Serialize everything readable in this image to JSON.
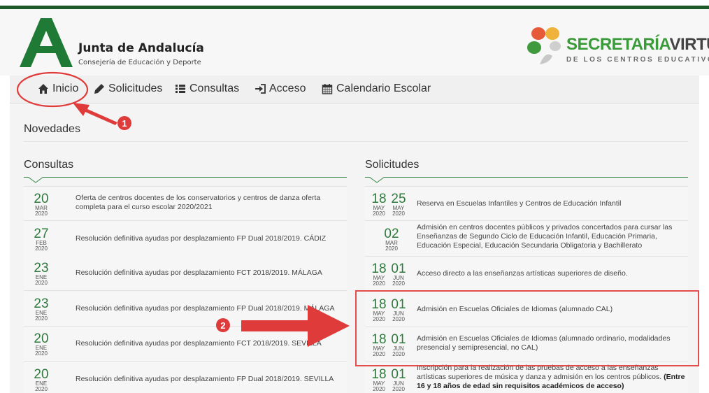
{
  "header": {
    "org_name": "Junta de Andalucía",
    "org_sub": "Consejería de Educación y Deporte",
    "sv_title_a": "SECRETARÍA",
    "sv_title_b": "VIRTUAL",
    "sv_sub": "DE LOS CENTROS EDUCATIVOS"
  },
  "nav": {
    "items": [
      {
        "label": "Inicio",
        "icon": "home-icon"
      },
      {
        "label": "Solicitudes",
        "icon": "pencil-icon"
      },
      {
        "label": "Consultas",
        "icon": "list-icon"
      },
      {
        "label": "Acceso",
        "icon": "sign-in-icon"
      },
      {
        "label": "Calendario Escolar",
        "icon": "calendar-icon"
      }
    ]
  },
  "novedades": "Novedades",
  "consultas": {
    "title": "Consultas",
    "rows": [
      {
        "day": "20",
        "month": "MAR",
        "year": "2020",
        "text": "Oferta de centros docentes de los conservatorios y centros de danza oferta completa para el curso escolar 2020/2021"
      },
      {
        "day": "27",
        "month": "FEB",
        "year": "2020",
        "text": "Resolución definitiva ayudas por desplazamiento FP Dual 2018/2019. CÁDIZ"
      },
      {
        "day": "23",
        "month": "ENE",
        "year": "2020",
        "text": "Resolución definitiva ayudas por desplazamiento FCT 2018/2019. MÁLAGA"
      },
      {
        "day": "23",
        "month": "ENE",
        "year": "2020",
        "text": "Resolución definitiva ayudas por desplazamiento FP Dual 2018/2019. MÁLAGA"
      },
      {
        "day": "20",
        "month": "ENE",
        "year": "2020",
        "text": "Resolución definitiva ayudas por desplazamiento FCT 2018/2019. SEVILLA"
      },
      {
        "day": "20",
        "month": "ENE",
        "year": "2020",
        "text": "Resolución definitiva ayudas por desplazamiento FP Dual 2018/2019. SEVILLA"
      }
    ]
  },
  "solicitudes": {
    "title": "Solicitudes",
    "rows": [
      {
        "d1": "18",
        "m1": "MAY",
        "y1": "2020",
        "d2": "25",
        "m2": "MAY",
        "y2": "2020",
        "text": "Reserva en Escuelas Infantiles y Centros de Educación Infantil",
        "bold": ""
      },
      {
        "d1": "02",
        "m1": "MAR",
        "y1": "2020",
        "d2": "",
        "m2": "",
        "y2": "",
        "text": "Admisión en centros docentes públicos y privados concertados para cursar las Enseñanzas de Segundo Ciclo de Educación Infantil, Educación Primaria, Educación Especial, Educación Secundaria Obligatoria y Bachillerato",
        "bold": ""
      },
      {
        "d1": "18",
        "m1": "MAY",
        "y1": "2020",
        "d2": "01",
        "m2": "JUN",
        "y2": "2020",
        "text": "Acceso directo a las enseñanzas artísticas superiores de diseño.",
        "bold": ""
      },
      {
        "d1": "18",
        "m1": "MAY",
        "y1": "2020",
        "d2": "01",
        "m2": "JUN",
        "y2": "2020",
        "text": "Admisión en Escuelas Oficiales de Idiomas (alumnado CAL)",
        "bold": ""
      },
      {
        "d1": "18",
        "m1": "MAY",
        "y1": "2020",
        "d2": "01",
        "m2": "JUN",
        "y2": "2020",
        "text": "Admisión en Escuelas Oficiales de Idiomas (alumnado ordinario, modalidades presencial y semipresencial, no CAL)",
        "bold": ""
      },
      {
        "d1": "18",
        "m1": "MAY",
        "y1": "2020",
        "d2": "01",
        "m2": "JUN",
        "y2": "2020",
        "text": "Inscripción para la realización de las pruebas de acceso a las enseñanzas artísticas superiores de música y danza y admisión en los centros públicos. ",
        "bold": "(Entre 16 y 18 años de edad sin requisitos académicos de acceso)"
      }
    ]
  },
  "annotations": {
    "marker1": "1",
    "marker2": "2",
    "color": "#e03b3b"
  }
}
